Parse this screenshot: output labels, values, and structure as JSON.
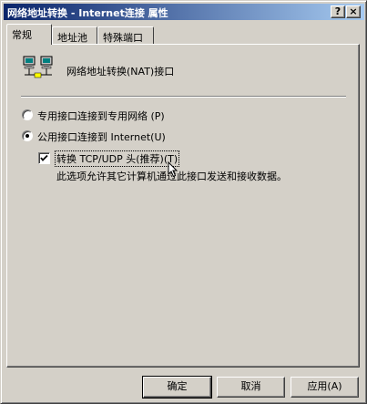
{
  "window": {
    "title": "网络地址转换 - Internet连接 属性",
    "help_button": "?",
    "close_button": "×"
  },
  "tabs": [
    {
      "label": "常规",
      "active": true
    },
    {
      "label": "地址池",
      "active": false
    },
    {
      "label": "特殊端口",
      "active": false
    }
  ],
  "header": {
    "icon": "network-computers-icon",
    "label": "网络地址转换(NAT)接口"
  },
  "options": {
    "private_label": "专用接口连接到专用网络 (P)",
    "private_selected": false,
    "public_label": "公用接口连接到 Internet(U)",
    "public_selected": true,
    "translate_label": "转换 TCP/UDP 头(推荐)(T)",
    "translate_checked": true,
    "translate_description": "此选项允许其它计算机通过此接口发送和接收数据。"
  },
  "buttons": {
    "ok": "确定",
    "cancel": "取消",
    "apply": "应用(A)"
  }
}
